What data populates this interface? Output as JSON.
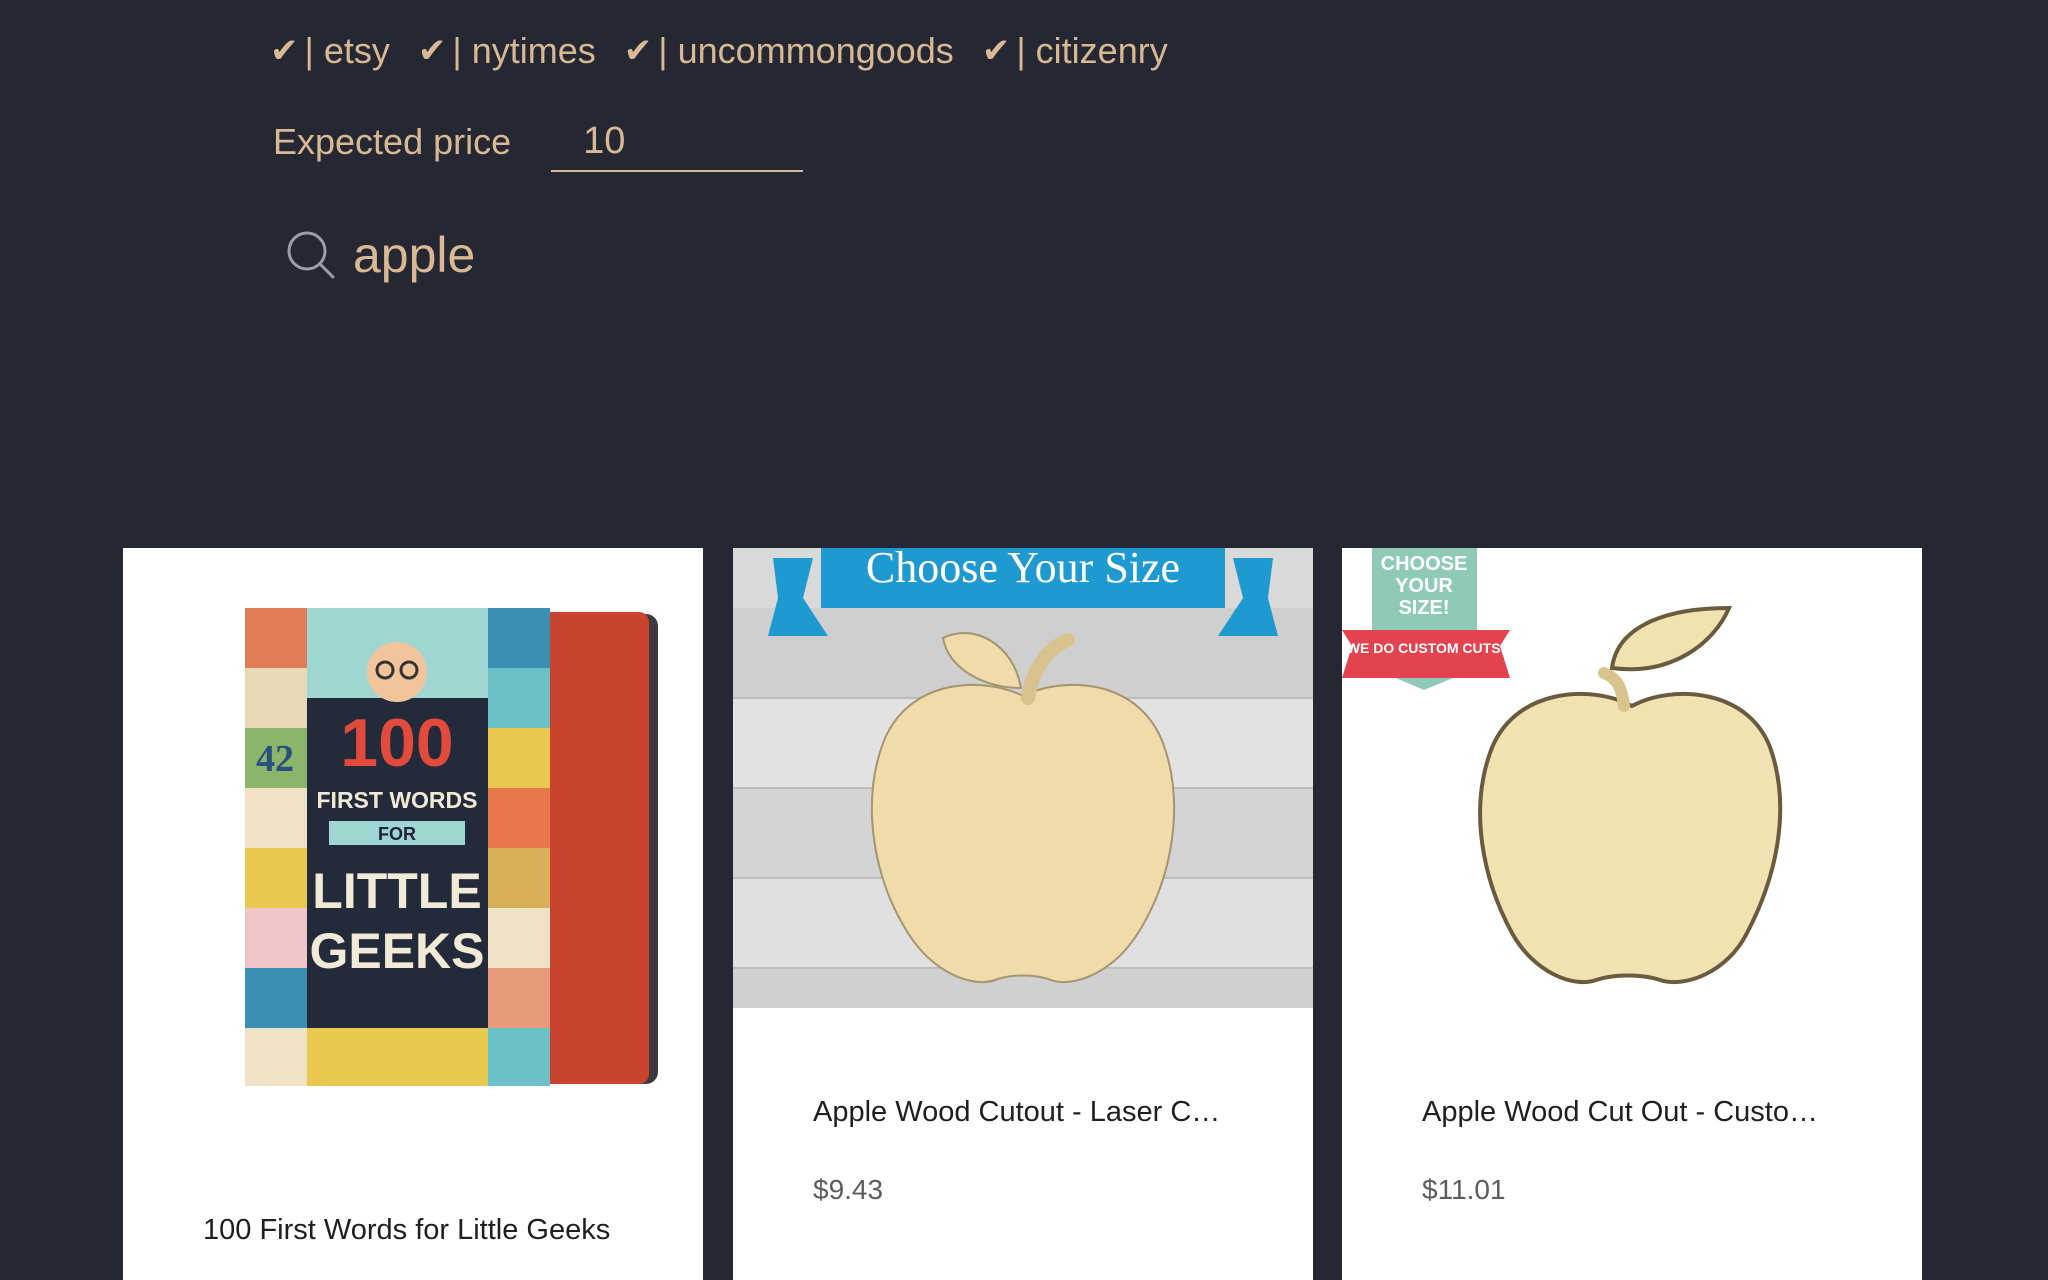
{
  "sources": [
    {
      "check": "✔",
      "bar": "|",
      "label": "etsy"
    },
    {
      "check": "✔",
      "bar": "|",
      "label": "nytimes"
    },
    {
      "check": "✔",
      "bar": "|",
      "label": "uncommongoods"
    },
    {
      "check": "✔",
      "bar": "|",
      "label": "citizenry"
    }
  ],
  "price": {
    "label": "Expected price",
    "value": "10"
  },
  "search": {
    "value": "apple",
    "icon": "search-icon"
  },
  "products": [
    {
      "title": "100 First Words for Little Geeks",
      "book": {
        "number": "100",
        "line1": "FIRST WORDS",
        "line2": "FOR",
        "line3": "LITTLE",
        "line4": "GEEKS",
        "tile_42": "42"
      }
    },
    {
      "title": "Apple Wood Cutout - Laser C…",
      "price": "$9.43",
      "banner": "Choose Your Size"
    },
    {
      "title": "Apple Wood Cut Out - Custo…",
      "price": "$11.01",
      "badge_top": [
        "CHOOSE",
        "YOUR",
        "SIZE!"
      ],
      "badge_ribbon": "WE DO CUSTOM CUTS!"
    }
  ],
  "colors": {
    "background": "#252833",
    "accent": "#d8b993"
  }
}
